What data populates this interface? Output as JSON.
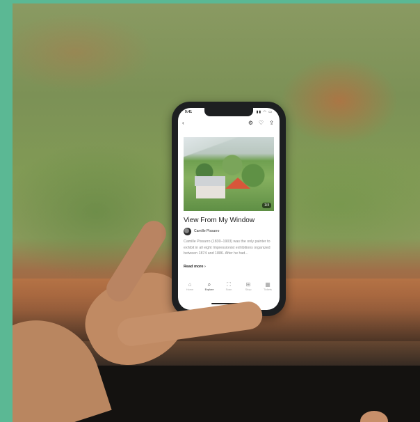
{
  "photo": {
    "subject": "hand holding smartphone in front of blurred painting",
    "accent_color": "#5bb894"
  },
  "phone": {
    "status": {
      "time": "9:41",
      "icons": "▮▮ ◠ ▭"
    },
    "toolbar": {
      "back": "‹",
      "settings": "⚙",
      "favorite": "♡",
      "share": "⇪"
    },
    "artwork": {
      "counter": "1/4",
      "title": "View From My Window",
      "artist": "Camille Pissarro",
      "description": "Camille Pissarro (1830–1903) was the only painter to exhibit in all eight Impressionist exhibitions organized between 1874 and 1886. After he had...",
      "read_more": "Read more  ›"
    },
    "tabs": [
      {
        "icon": "⌂",
        "label": "Home"
      },
      {
        "icon": "⌕",
        "label": "Explore"
      },
      {
        "icon": "⛶",
        "label": "Scan"
      },
      {
        "icon": "⊞",
        "label": "Shop"
      },
      {
        "icon": "▦",
        "label": "Tickets"
      }
    ]
  }
}
